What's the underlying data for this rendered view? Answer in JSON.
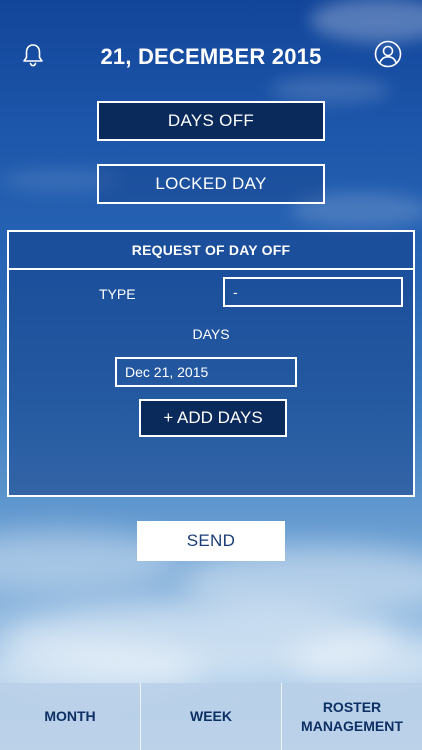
{
  "header": {
    "date_title": "21, DECEMBER 2015",
    "bell_icon": "bell-icon",
    "profile_icon": "user-circle-icon"
  },
  "actions": {
    "days_off_label": "DAYS OFF",
    "locked_day_label": "LOCKED DAY"
  },
  "request_panel": {
    "title": "REQUEST OF DAY OFF",
    "type_label": "TYPE",
    "type_value": "-",
    "days_label": "DAYS",
    "date_value": "Dec 21, 2015",
    "add_days_label": "+ ADD DAYS"
  },
  "send_label": "SEND",
  "tabs": [
    {
      "label": "MONTH"
    },
    {
      "label": "WEEK"
    },
    {
      "label_line1": "ROSTER",
      "label_line2": "MANAGEMENT"
    }
  ],
  "colors": {
    "primary_dark": "#0b2a5c",
    "tab_text": "#0d2f63",
    "white": "#ffffff"
  }
}
